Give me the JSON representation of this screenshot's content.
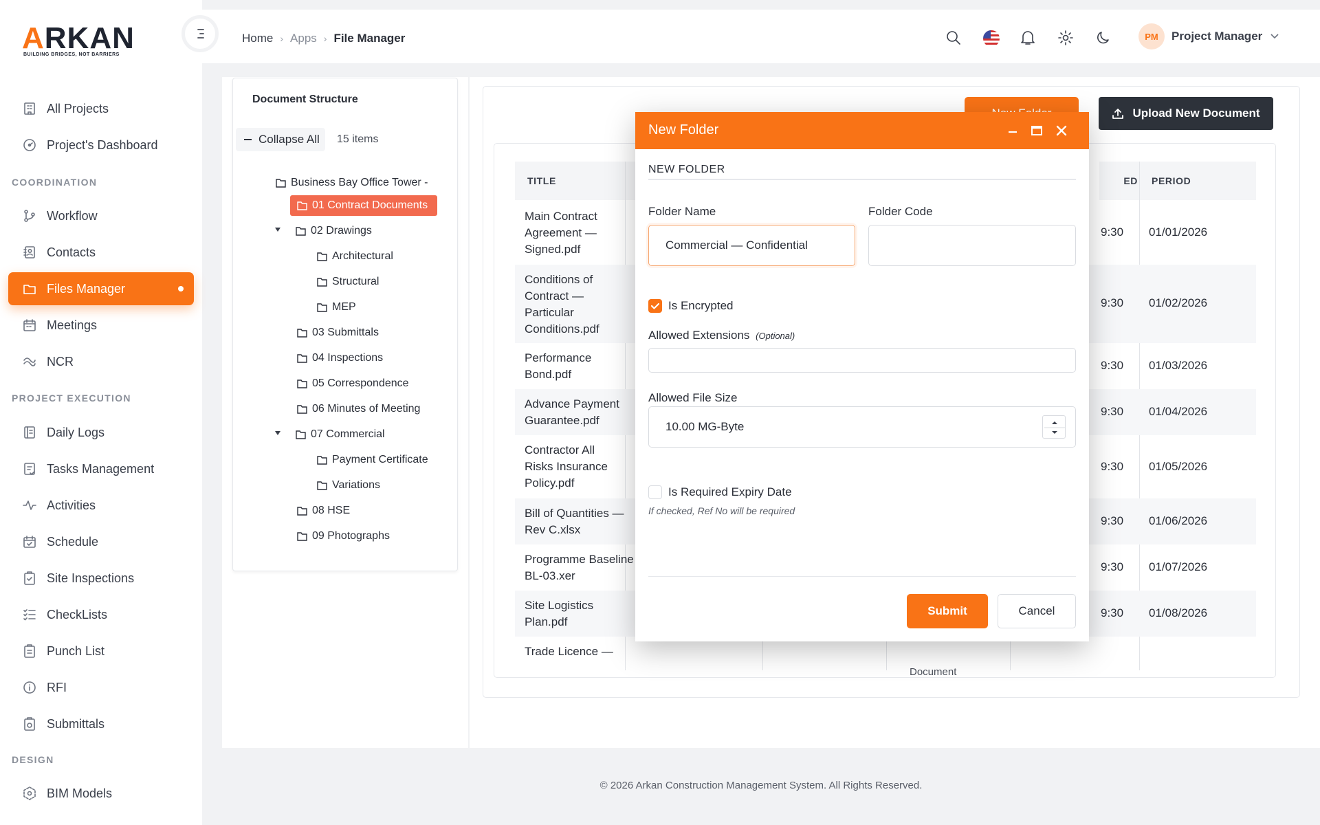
{
  "brand": {
    "name_a": "A",
    "name_rest": "RKAN",
    "tagline": "BUILDING BRIDGES, NOT BARRIERS",
    "accent": "#f97316"
  },
  "sidebar": {
    "items": [
      {
        "label": "All Projects",
        "icon": "building-icon"
      },
      {
        "label": "Project's Dashboard",
        "icon": "dashboard-icon"
      },
      {
        "label": "Workflow",
        "icon": "workflow-icon"
      },
      {
        "label": "Contacts",
        "icon": "contacts-icon"
      },
      {
        "label": "Files Manager",
        "icon": "folder-icon",
        "active": true
      },
      {
        "label": "Meetings",
        "icon": "calendar-icon"
      },
      {
        "label": "NCR",
        "icon": "ncr-icon"
      },
      {
        "label": "Daily Logs",
        "icon": "book-icon"
      },
      {
        "label": "Tasks Management",
        "icon": "tasks-icon"
      },
      {
        "label": "Activities",
        "icon": "activity-icon"
      },
      {
        "label": "Schedule",
        "icon": "schedule-icon"
      },
      {
        "label": "Site Inspections",
        "icon": "clipboard-check-icon"
      },
      {
        "label": "CheckLists",
        "icon": "checklist-icon"
      },
      {
        "label": "Punch List",
        "icon": "clipboard-icon"
      },
      {
        "label": "RFI",
        "icon": "info-icon"
      },
      {
        "label": "Submittals",
        "icon": "submittal-icon"
      },
      {
        "label": "BIM Models",
        "icon": "cube-icon"
      }
    ],
    "sections": [
      "COORDINATION",
      "PROJECT EXECUTION",
      "DESIGN"
    ]
  },
  "topbar": {
    "breadcrumb": [
      "Home",
      "Apps",
      "File Manager"
    ],
    "user_initials": "PM",
    "user_name": "Project Manager"
  },
  "tree": {
    "title": "Document Structure",
    "collapse_label": "Collapse All",
    "count": "15 items",
    "nodes": [
      "Business Bay Office Tower - ",
      "01 Contract Documents",
      "02 Drawings",
      "Architectural",
      "Structural",
      "MEP",
      "03 Submittals",
      "04 Inspections",
      "05 Correspondence",
      "06 Minutes of Meeting",
      "07 Commercial",
      "Payment Certificate",
      "Variations",
      "08 HSE",
      "09 Photographs"
    ]
  },
  "main": {
    "new_folder_label": "New Folder",
    "upload_label": "Upload New Document",
    "columns": {
      "title": "TITLE",
      "hidden_col": "ED",
      "period": "PERIOD"
    },
    "rows": [
      {
        "title": "Main Contract Agreement — Signed.pdf",
        "time": "9:30",
        "period": "01/01/2026"
      },
      {
        "title": "Conditions of Contract — Particular Conditions.pdf",
        "time": "9:30",
        "period": "01/02/2026"
      },
      {
        "title": "Performance Bond.pdf",
        "time": "9:30",
        "period": "01/03/2026"
      },
      {
        "title": "Advance Payment Guarantee.pdf",
        "time": "9:30",
        "period": "01/04/2026"
      },
      {
        "title": "Contractor All Risks Insurance Policy.pdf",
        "time": "9:30",
        "period": "01/05/2026"
      },
      {
        "title": "Bill of Quantities — Rev C.xlsx",
        "time": "9:30",
        "period": "01/06/2026"
      },
      {
        "title": "Programme Baseline BL-03.xer",
        "time": "9:30",
        "period": "01/07/2026"
      },
      {
        "title": "Site Logistics Plan.pdf",
        "time": "9:30",
        "period": "01/08/2026"
      },
      {
        "title": "Trade Licence —",
        "time": "",
        "period": ""
      }
    ],
    "partial_cell": "Document"
  },
  "modal": {
    "title": "New Folder",
    "section_title": "NEW FOLDER",
    "folder_name_label": "Folder Name",
    "folder_name_value": "Commercial — Confidential",
    "folder_code_label": "Folder Code",
    "folder_code_value": "",
    "encrypted_label": "Is Encrypted",
    "encrypted": true,
    "extensions_label": "Allowed Extensions",
    "extensions_optional": "(Optional)",
    "extensions_value": "",
    "file_size_label": "Allowed File Size",
    "file_size_value": "10.00 MG-Byte",
    "expiry_label": "Is Required Expiry Date",
    "expiry_checked": false,
    "expiry_hint": "If checked, Ref No will be required",
    "submit_label": "Submit",
    "cancel_label": "Cancel"
  },
  "footer": "© 2026 Arkan Construction Management System. All Rights Reserved."
}
